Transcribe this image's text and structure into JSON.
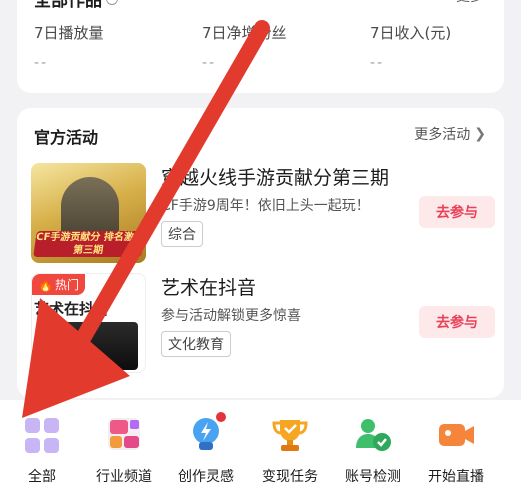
{
  "stats": {
    "title": "全部作品",
    "more": "更多",
    "items": [
      {
        "label": "7日播放量",
        "value": "--"
      },
      {
        "label": "7日净增粉丝",
        "value": "--"
      },
      {
        "label": "7日收入(元)",
        "value": "--"
      }
    ]
  },
  "activities": {
    "title": "官方活动",
    "more": "更多活动",
    "items": [
      {
        "title": "穿越火线手游贡献分第三期",
        "subtitle": "CF手游9周年！依旧上头一起玩！",
        "tag": "综合",
        "button": "去参与",
        "thumb_text": "CF手游贡献分 排名激励第三期"
      },
      {
        "title": "艺术在抖音",
        "subtitle": "参与活动解锁更多惊喜",
        "tag": "文化教育",
        "button": "去参与",
        "badge": "热门",
        "thumb_text": "艺术在抖音"
      }
    ]
  },
  "toolbar": {
    "items": [
      {
        "label": "全部",
        "icon": "grid-icon"
      },
      {
        "label": "行业频道",
        "icon": "industry-channel-icon"
      },
      {
        "label": "创作灵感",
        "icon": "lightbulb-icon"
      },
      {
        "label": "变现任务",
        "icon": "trophy-icon"
      },
      {
        "label": "账号检测",
        "icon": "account-check-icon"
      },
      {
        "label": "开始直播",
        "icon": "live-camera-icon"
      }
    ]
  },
  "colors": {
    "accent_red": "#e94157",
    "arrow_red": "#e23b2e",
    "join_bg": "#fde8ea"
  }
}
